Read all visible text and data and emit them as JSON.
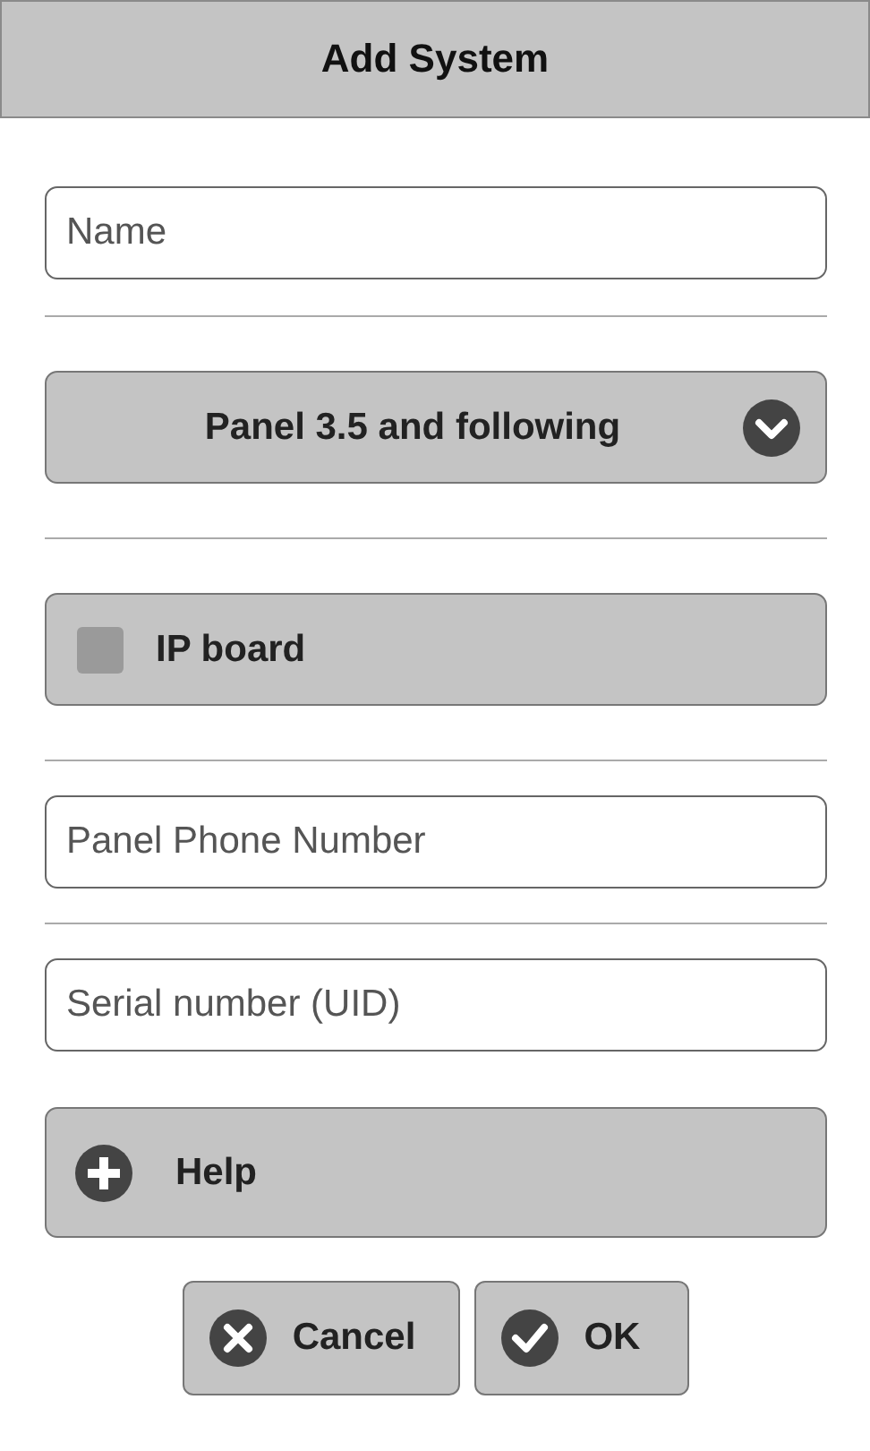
{
  "header": {
    "title": "Add System"
  },
  "name_field": {
    "placeholder": "Name"
  },
  "panel_select": {
    "value": "Panel 3.5 and following"
  },
  "ip_board": {
    "label": "IP board",
    "checked": false
  },
  "phone_field": {
    "placeholder": "Panel Phone Number"
  },
  "serial_field": {
    "placeholder": "Serial number (UID)"
  },
  "help": {
    "label": "Help",
    "expanded": false
  },
  "buttons": [
    {
      "kind": "cancel",
      "label": "Cancel"
    },
    {
      "kind": "ok",
      "label": "OK"
    }
  ]
}
